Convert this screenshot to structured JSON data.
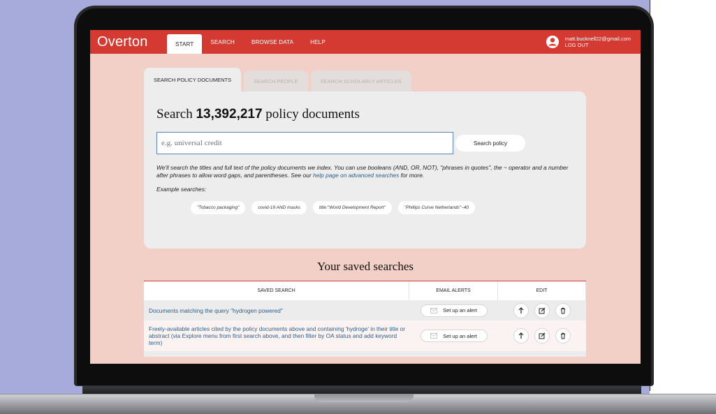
{
  "app": {
    "logo": "Overton"
  },
  "nav": {
    "items": [
      {
        "label": "START",
        "active": true
      },
      {
        "label": "SEARCH",
        "active": false
      },
      {
        "label": "BROWSE DATA",
        "active": false
      },
      {
        "label": "HELP",
        "active": false
      }
    ],
    "user_email": "matt.bucknell22@gmail.com",
    "logout_label": "LOG OUT"
  },
  "tabs": [
    {
      "label": "SEARCH POLICY DOCUMENTS",
      "active": true
    },
    {
      "label": "SEARCH PEOPLE",
      "active": false
    },
    {
      "label": "SEARCH SCHOLARLY ARTICLES",
      "active": false
    }
  ],
  "search": {
    "title_prefix": "Search ",
    "count": "13,392,217",
    "title_suffix": " policy documents",
    "placeholder": "e.g. universal credit",
    "button_label": "Search policy",
    "help_text": "We'll search the titles and full text of the policy documents we index. You can use booleans (AND, OR, NOT), \"phrases in quotes\", the ~ operator and a number after phrases to allow word gaps, and parentheses. See our ",
    "help_link": "help page on advanced searches",
    "help_suffix": " for more.",
    "examples_label": "Example searches:",
    "examples": [
      "\"Tobacco packaging\"",
      "covid-19 AND masks",
      "title:\"World Development Report\"",
      "\"Phillips Curve Netherlands\"~40"
    ]
  },
  "saved": {
    "title": "Your saved searches",
    "headers": {
      "search": "SAVED SEARCH",
      "alerts": "EMAIL ALERTS",
      "edit": "EDIT"
    },
    "alert_label": "Set up an alert",
    "rows": [
      {
        "text": "Documents matching the query \"hydrogen powered\""
      },
      {
        "text": "Freely-available articles cited by the policy documents above and containing 'hydroge' in their title or abstract (via Explore menu from first search above, and then filter by OA status and add keyword term)"
      }
    ]
  },
  "colors": {
    "brand": "#d43a31",
    "link": "#2d5d8a",
    "page_bg": "#f2cfc7"
  }
}
